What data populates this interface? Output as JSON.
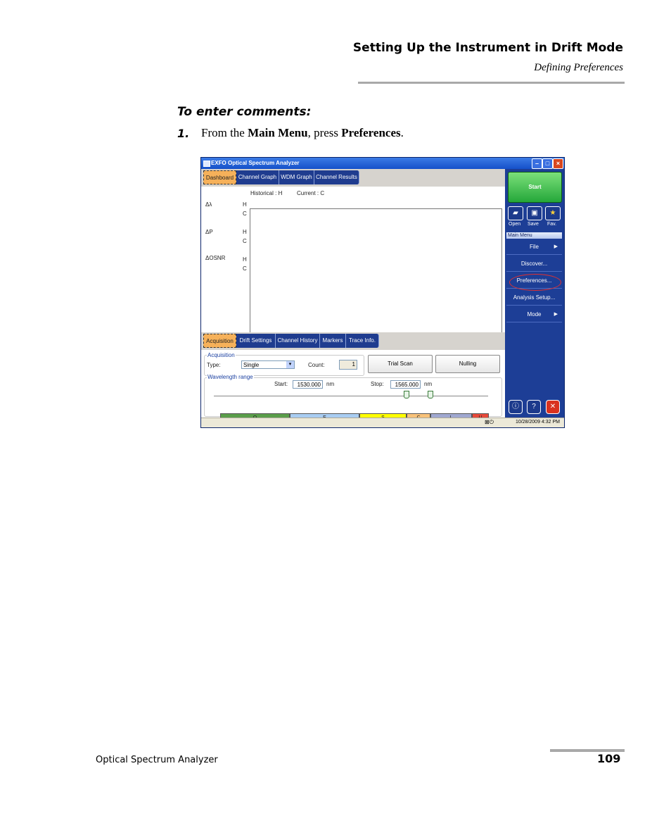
{
  "header": {
    "title": "Setting Up the Instrument in Drift Mode",
    "subtitle": "Defining Preferences"
  },
  "procedure": {
    "heading": "To enter comments:",
    "step_number": "1.",
    "step_prefix": "From the ",
    "step_bold1": "Main Menu",
    "step_mid": ", press ",
    "step_bold2": "Preferences",
    "step_suffix": "."
  },
  "window": {
    "title": "EXFO Optical Spectrum Analyzer",
    "top_tabs": [
      "Dashboard",
      "Channel Graph",
      "WDM Graph",
      "Channel Results"
    ],
    "legend_historical": "Historical : H",
    "legend_current": "Current : C",
    "metrics": [
      {
        "label": "Δλ",
        "h": "H",
        "c": "C"
      },
      {
        "label": "ΔP",
        "h": "H",
        "c": "C"
      },
      {
        "label": "ΔOSNR",
        "h": "H",
        "c": "C"
      }
    ],
    "bottom_tabs": [
      "Acquisition",
      "Drift Settings",
      "Channel History",
      "Markers",
      "Trace Info."
    ],
    "acquisition": {
      "legend": "Acquisition",
      "type_label": "Type:",
      "type_value": "Single",
      "count_label": "Count:",
      "count_value": "1",
      "trial_scan": "Trial Scan",
      "nulling": "Nulling"
    },
    "wavelength": {
      "legend": "Wavelength range",
      "start_label": "Start:",
      "start_value": "1530.000",
      "stop_label": "Stop:",
      "stop_value": "1565.000",
      "unit": "nm",
      "bands": [
        "O",
        "E",
        "S",
        "C",
        "L",
        "U"
      ]
    },
    "side": {
      "start": "Start",
      "open": "Open",
      "save": "Save",
      "fav": "Fav.",
      "menu_header": "Main Menu",
      "menu_items": [
        "File",
        "Discover...",
        "Preferences...",
        "Analysis Setup...",
        "Mode"
      ]
    },
    "status_time": "10/28/2009 4:32 PM"
  },
  "footer": {
    "product": "Optical Spectrum Analyzer",
    "page": "109"
  },
  "colors": {
    "band_O": "#5a9e4a",
    "band_E": "#a9cdf2",
    "band_S": "#ffff00",
    "band_C": "#f8c27a",
    "band_L": "#a0a8d0",
    "band_U": "#e64a3a",
    "menu_blue": "#1d3e96",
    "highlight_circle": "#e03030"
  }
}
